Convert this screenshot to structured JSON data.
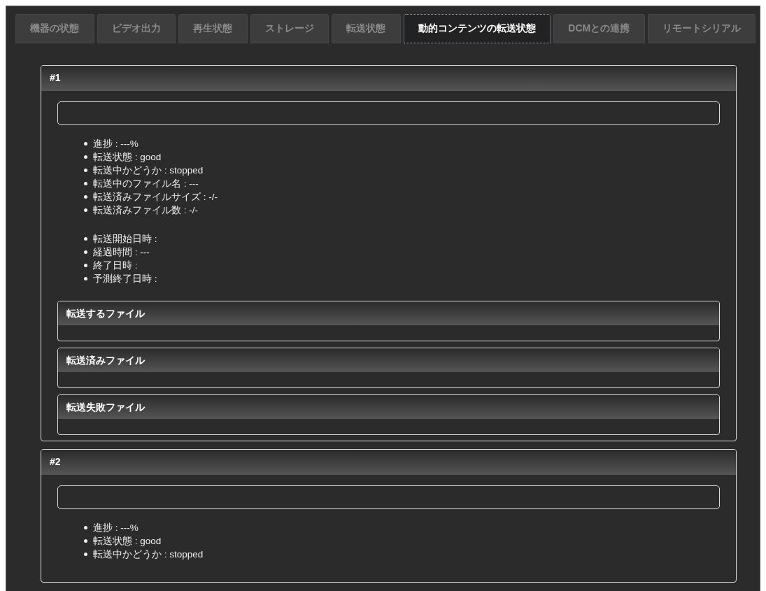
{
  "tabs": [
    {
      "label": "機器の状態",
      "selected": false
    },
    {
      "label": "ビデオ出力",
      "selected": false
    },
    {
      "label": "再生状態",
      "selected": false
    },
    {
      "label": "ストレージ",
      "selected": false
    },
    {
      "label": "転送状態",
      "selected": false
    },
    {
      "label": "動的コンテンツの転送状態",
      "selected": true
    },
    {
      "label": "DCMとの連携",
      "selected": false
    },
    {
      "label": "リモートシリアル",
      "selected": false
    }
  ],
  "transfers": [
    {
      "title": "#1",
      "progress": {
        "level": 0
      },
      "status_groups": [
        [
          "進捗 : ---%",
          "転送状態 : good",
          "転送中かどうか : stopped",
          "転送中のファイル名 : ---",
          "転送済みファイルサイズ : -/-",
          "転送済みファイル数 : -/-"
        ],
        [
          "転送開始日時 :",
          "経過時間 : ---",
          "終了日時 :",
          "予測終了日時 :"
        ]
      ],
      "file_sections": [
        {
          "title": "転送するファイル"
        },
        {
          "title": "転送済みファイル"
        },
        {
          "title": "転送失敗ファイル"
        }
      ]
    },
    {
      "title": "#2",
      "progress": {
        "level": 0
      },
      "status_groups": [
        [
          "進捗 : ---%",
          "転送状態 : good",
          "転送中かどうか : stopped"
        ]
      ]
    }
  ]
}
